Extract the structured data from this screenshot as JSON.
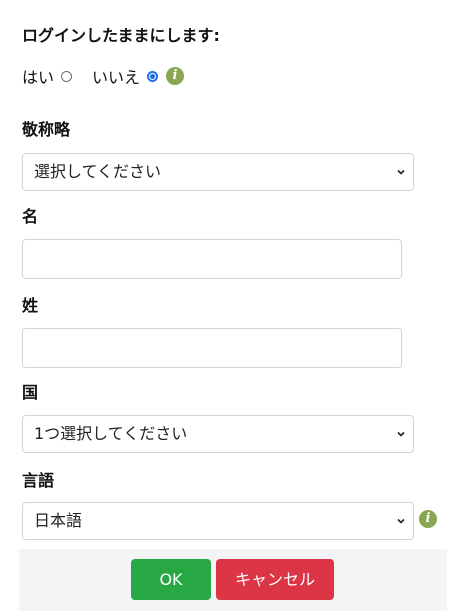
{
  "stay_logged_in": {
    "title": "ログインしたままにします:",
    "yes_label": "はい",
    "no_label": "いいえ",
    "selected": "いいえ"
  },
  "honorific": {
    "label": "敬称略",
    "value": "選択してください"
  },
  "first_name": {
    "label": "名",
    "value": ""
  },
  "last_name": {
    "label": "姓",
    "value": ""
  },
  "country": {
    "label": "国",
    "value": "1つ選択してください"
  },
  "language": {
    "label": "言語",
    "value": "日本語"
  },
  "buttons": {
    "ok_label": "OK",
    "cancel_label": "キャンセル"
  },
  "icons": {
    "info": "info-icon",
    "dropdown": "chevron-down-icon"
  },
  "colors": {
    "ok": "#28a745",
    "cancel": "#dc3545",
    "radio_selected": "#1f6fe0",
    "info_icon": "#8aa653",
    "footer_bg": "#f3f4f6"
  }
}
